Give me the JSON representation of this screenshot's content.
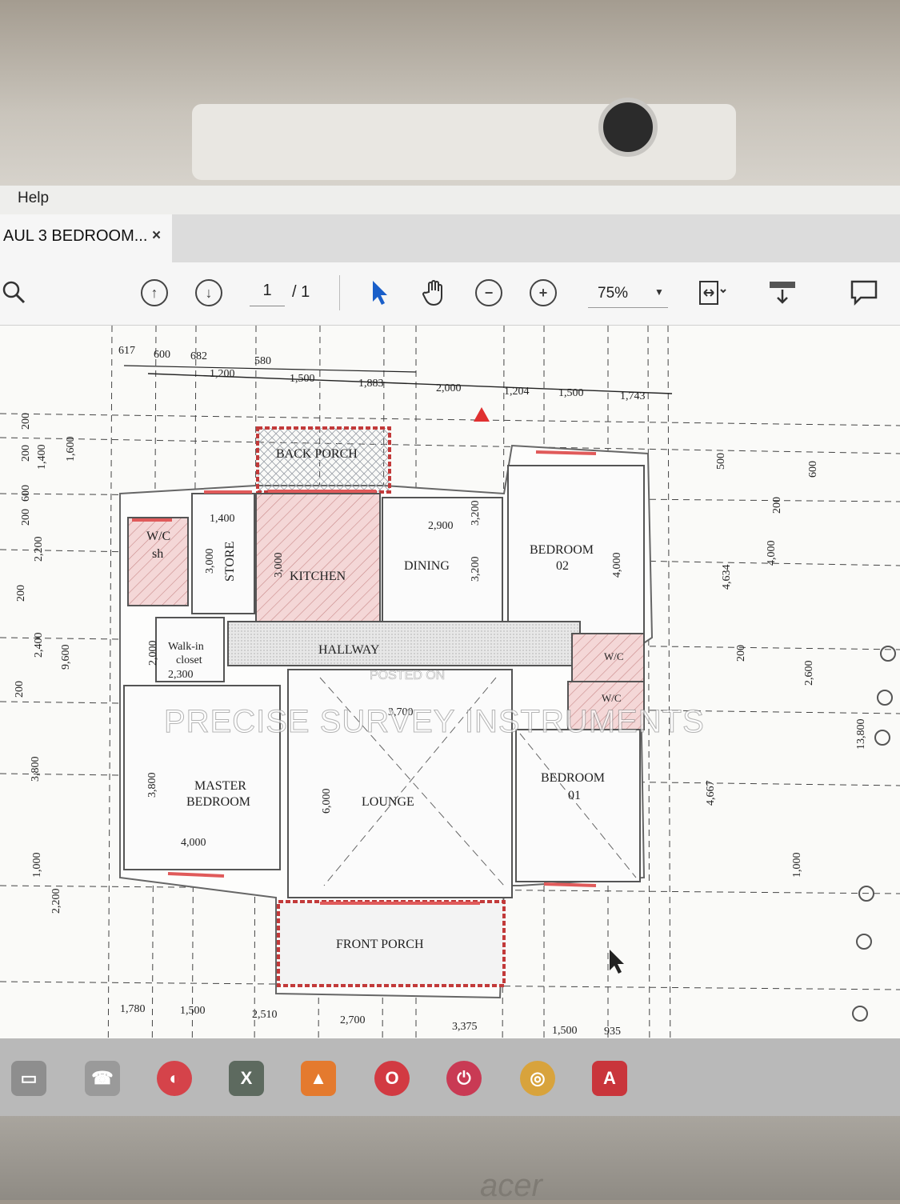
{
  "menu": {
    "help": "Help"
  },
  "tab": {
    "title": "AUL 3 BEDROOM...",
    "close": "×"
  },
  "toolbar": {
    "page_current": "1",
    "page_total": "/ 1",
    "zoom": "75%",
    "icons": [
      "search-icon",
      "page-up-icon",
      "page-down-icon",
      "select-arrow-icon",
      "hand-icon",
      "zoom-out-icon",
      "zoom-in-icon",
      "fit-page-icon",
      "scroll-mode-icon",
      "comment-icon"
    ]
  },
  "plan": {
    "rooms": {
      "back_porch": "BACK PORCH",
      "wc_sh": "W/C",
      "sh": "sh",
      "store": "STORE",
      "kitchen": "KITCHEN",
      "dining": "DINING",
      "bedroom02": "BEDROOM",
      "bedroom02_num": "02",
      "walk_in": "Walk-in",
      "closet": "closet",
      "hallway": "HALLWAY",
      "wc2": "W/C",
      "wc3": "W/C",
      "master1": "MASTER",
      "master2": "BEDROOM",
      "lounge": "LOUNGE",
      "bedroom01": "BEDROOM",
      "bedroom01_num": "01",
      "front_porch": "FRONT PORCH"
    },
    "dims_top": [
      "617",
      "600",
      "682",
      "580",
      "1,200",
      "1,500",
      "1,883",
      "2,000",
      "1,204",
      "1,500",
      "1,743"
    ],
    "dims_inner": [
      "1,400",
      "3,000",
      "3,000",
      "2,900",
      "3,200",
      "3,200",
      "4,000",
      "2,000",
      "2,300",
      "3,800",
      "6,000",
      "3,700",
      "4,000"
    ],
    "dims_left": [
      "200",
      "200",
      "600",
      "200",
      "1,400",
      "1,600",
      "200",
      "2,200",
      "2,400",
      "9,600",
      "200",
      "3,800",
      "1,000",
      "2,200"
    ],
    "dims_right": [
      "500",
      "600",
      "200",
      "4,634",
      "4,000",
      "200",
      "2,600",
      "4,667",
      "1,000",
      "13,800"
    ],
    "dims_bottom": [
      "1,780",
      "1,500",
      "2,510",
      "2,700",
      "3,375",
      "1,500",
      "935"
    ]
  },
  "watermark": {
    "main": "PRECISE SURVEY INSTRUMENTS",
    "small": "POSTED ON"
  },
  "brand": "acer",
  "taskbar": {
    "icons": [
      "file-explorer-icon",
      "phone-icon",
      "paint-icon",
      "excel-icon",
      "vlc-icon",
      "opera-icon",
      "power-icon",
      "chrome-icon",
      "acrobat-icon"
    ]
  },
  "colors": {
    "accent": "#1a5fc9",
    "hatch": "#e8a6a6",
    "wall": "#c23a3a"
  }
}
